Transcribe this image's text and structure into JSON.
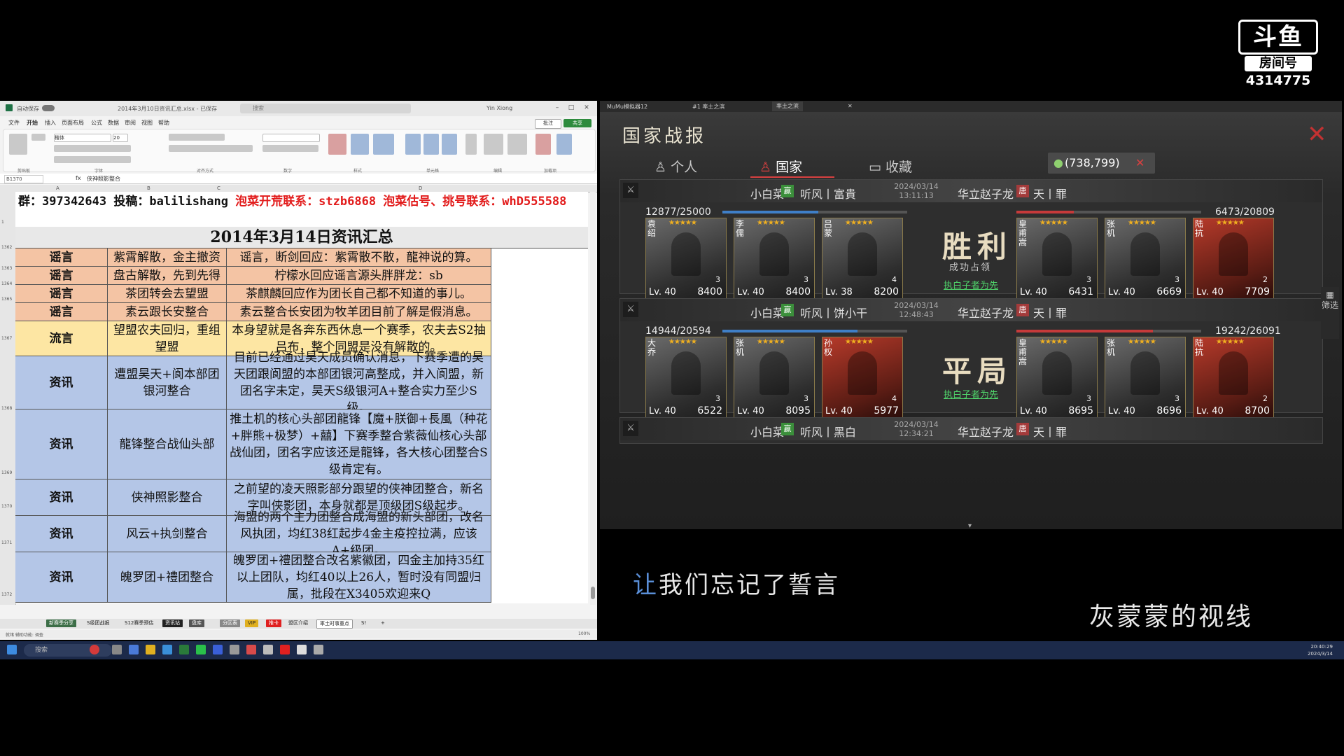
{
  "stream": {
    "platform_logo": "斗鱼",
    "room_label": "房间号",
    "room_number": "4314775"
  },
  "excel": {
    "title": "2014年3月10日资讯汇总.xlsx - 已保存",
    "search_placeholder": "搜索",
    "account": "Yin Xiong",
    "autosave_label": "自动保存",
    "menu": [
      "文件",
      "开始",
      "插入",
      "页面布局",
      "公式",
      "数据",
      "审阅",
      "视图",
      "帮助"
    ],
    "comment_label": "批注",
    "share_label": "共享",
    "ribbon_groups": [
      "剪贴板",
      "字体",
      "对齐方式",
      "数字",
      "样式",
      "单元格",
      "编辑",
      "加载项"
    ],
    "font_name": "楷体",
    "font_size": "20",
    "name_box": "B1370",
    "formula_value": "侠神照影整合",
    "columns": [
      "A",
      "B",
      "C",
      "D"
    ],
    "row_numbers": [
      "1",
      "1362",
      "1363",
      "1364",
      "1365",
      "1367",
      "1368",
      "1369",
      "1370",
      "1371",
      "1372"
    ],
    "group_line_prefix": "群：397342643  投稿：balilishang ",
    "group_line_contact": "泡菜开荒联系：stzb6868  泡菜估号、挑号联系：whD555588",
    "summary_title": "2014年3月14日资讯汇总",
    "rows": [
      {
        "type": "谣言",
        "topic": "紫霄解散，金主撤资",
        "detail": "谣言，断剑回应：紫霄散不散，龍神说的算。",
        "color": "pink"
      },
      {
        "type": "谣言",
        "topic": "盘古解散，先到先得",
        "detail": "柠檬水回应谣言源头胖胖龙：sb",
        "color": "pink"
      },
      {
        "type": "谣言",
        "topic": "茶团转会去望盟",
        "detail": "茶麒麟回应作为团长自己都不知道的事儿。",
        "color": "pink"
      },
      {
        "type": "谣言",
        "topic": "素云跟长安整合",
        "detail": "素云整合长安团为牧羊团目前了解是假消息。",
        "color": "pink"
      },
      {
        "type": "流言",
        "topic": "望盟农夫回归，重组望盟",
        "detail": "本身望就是各奔东西休息一个赛季，农夫去S2抽吕布，整个同盟是没有解散的。",
        "color": "yellow"
      },
      {
        "type": "资讯",
        "topic": "遭盟昊天+阆本部团银河整合",
        "detail": "目前已经通过昊天成员确认消息，下赛季遭的昊天团跟阆盟的本部团银河高整成，并入阆盟，新团名字未定，昊天S级银河A+整合实力至少S级。",
        "color": "blue"
      },
      {
        "type": "资讯",
        "topic": "龍锋整合战仙头部",
        "detail": "推土机的核心头部团龍锋【魔+朕御+長風（种花+胖熊+极梦）+囍】下赛季整合紫薇仙核心头部战仙团，团名字应该还是龍锋，各大核心团整合S级肯定有。",
        "color": "blue"
      },
      {
        "type": "资讯",
        "topic": "侠神照影整合",
        "detail": "之前望的凌天照影部分跟望的侠神团整合，新名字叫侠影团，本身就都是顶级团S级起步。",
        "color": "blue"
      },
      {
        "type": "资讯",
        "topic": "风云+执剑整合",
        "detail": "海盟的两个主力团整合成海盟的新头部团，改名风执团，均红38红起步4金主疫控拉满，应该A+级团。",
        "color": "blue"
      },
      {
        "type": "资讯",
        "topic": "魄罗团+禮团整合",
        "detail": "魄罗团+禮团整合改名紫徽团，四金主加持35红以上团队，均红40以上26人，暂时没有同盟归属，批段在X3405欢迎来Q",
        "color": "blue"
      }
    ],
    "sheet_tabs": [
      "新赛季分享",
      "S级团战报",
      "S12赛季预估",
      "资讯站",
      "盘库",
      "分区表",
      "VIP",
      "推卡",
      "盟区介绍",
      "率土时事重点",
      "S!"
    ],
    "status_text": "就绪  辅助功能: 调查",
    "zoom": "100%"
  },
  "game": {
    "browser_tabs": [
      "MuMu模拟器12",
      "#1 率土之滨",
      "率土之滨"
    ],
    "heading": "国家战报",
    "tabs": [
      "个人",
      "国家",
      "收藏"
    ],
    "active_tab": "国家",
    "coordinates": "(738,799)",
    "filter_label": "筛选",
    "reports": [
      {
        "attacker": "小白菜",
        "attacker_badge": "赢",
        "attacker_group": "听风丨富貴",
        "date": "2024/03/14",
        "time": "13:11:13",
        "defender": "华立赵子龙",
        "defender_badge": "唐",
        "defender_group": "天丨罪",
        "attacker_hp": "12877/25000",
        "attacker_ratio": 0.52,
        "defender_hp": "6473/20809",
        "defender_ratio": 0.31,
        "result": "胜利",
        "result_sub": "成功占领",
        "link": "执白子者为先",
        "attacker_cards": [
          {
            "name": "袁绍",
            "stars": "★★★★★",
            "level": "Lv. 40",
            "power": "8400",
            "troops": "3",
            "tone": "grey"
          },
          {
            "name": "李儒",
            "stars": "★★★★★",
            "level": "Lv. 40",
            "power": "8400",
            "troops": "3",
            "tone": "grey"
          },
          {
            "name": "吕蒙",
            "stars": "★★★★★",
            "level": "Lv. 38",
            "power": "8200",
            "troops": "4",
            "tone": "grey"
          }
        ],
        "defender_cards": [
          {
            "name": "皇甫嵩",
            "stars": "★★★★★",
            "level": "Lv. 40",
            "power": "6431",
            "troops": "3",
            "tone": "grey"
          },
          {
            "name": "张机",
            "stars": "★★★★★",
            "level": "Lv. 40",
            "power": "6669",
            "troops": "3",
            "tone": "grey"
          },
          {
            "name": "陆抗",
            "stars": "★★★★★",
            "level": "Lv. 40",
            "power": "7709",
            "troops": "2",
            "tone": "red"
          }
        ]
      },
      {
        "attacker": "小白菜",
        "attacker_badge": "赢",
        "attacker_group": "听风丨饼小干",
        "date": "2024/03/14",
        "time": "12:48:43",
        "defender": "华立赵子龙",
        "defender_badge": "唐",
        "defender_group": "天丨罪",
        "attacker_hp": "14944/20594",
        "attacker_ratio": 0.73,
        "defender_hp": "19242/26091",
        "defender_ratio": 0.74,
        "result": "平局",
        "result_sub": "",
        "link": "执白子者为先",
        "attacker_cards": [
          {
            "name": "大乔",
            "stars": "★★★★★",
            "level": "Lv. 40",
            "power": "6522",
            "troops": "3",
            "tone": "grey"
          },
          {
            "name": "张机",
            "stars": "★★★★★",
            "level": "Lv. 40",
            "power": "8095",
            "troops": "3",
            "tone": "grey"
          },
          {
            "name": "孙权",
            "stars": "★★★★★",
            "level": "Lv. 40",
            "power": "5977",
            "troops": "4",
            "tone": "red"
          }
        ],
        "defender_cards": [
          {
            "name": "皇甫嵩",
            "stars": "★★★★★",
            "level": "Lv. 40",
            "power": "8695",
            "troops": "3",
            "tone": "grey"
          },
          {
            "name": "张机",
            "stars": "★★★★★",
            "level": "Lv. 40",
            "power": "8696",
            "troops": "3",
            "tone": "grey"
          },
          {
            "name": "陆抗",
            "stars": "★★★★★",
            "level": "Lv. 40",
            "power": "8700",
            "troops": "2",
            "tone": "red"
          }
        ]
      },
      {
        "attacker": "小白菜",
        "attacker_badge": "赢",
        "attacker_group": "听风丨黑白",
        "date": "2024/03/14",
        "time": "12:34:21",
        "defender": "华立赵子龙",
        "defender_badge": "唐",
        "defender_group": "天丨罪"
      }
    ]
  },
  "subtitles": {
    "line1_first": "让",
    "line1_rest": "我们忘记了誓言",
    "line2": "灰蒙蒙的视线"
  },
  "taskbar": {
    "search_placeholder": "搜索",
    "time": "20:40:29",
    "date": "2024/3/14"
  }
}
